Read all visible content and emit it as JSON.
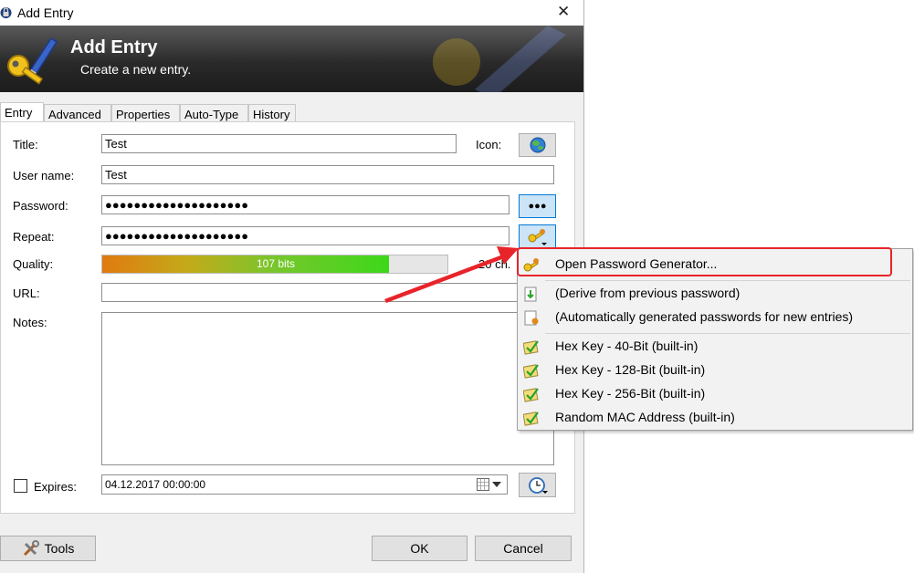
{
  "window": {
    "title": "Add Entry",
    "close_glyph": "✕",
    "icon": "lock-icon"
  },
  "banner": {
    "title": "Add Entry",
    "subtitle": "Create a new entry.",
    "icon": "key-pencil-icon"
  },
  "tabs": [
    {
      "label": "Entry",
      "active": true
    },
    {
      "label": "Advanced",
      "active": false
    },
    {
      "label": "Properties",
      "active": false
    },
    {
      "label": "Auto-Type",
      "active": false
    },
    {
      "label": "History",
      "active": false
    }
  ],
  "form": {
    "title_label": "Title:",
    "title_value": "Test",
    "icon_label": "Icon:",
    "username_label": "User name:",
    "username_value": "Test",
    "password_label": "Password:",
    "password_value": "●●●●●●●●●●●●●●●●●●●●",
    "show_password_glyph": "●●●",
    "repeat_label": "Repeat:",
    "repeat_value": "●●●●●●●●●●●●●●●●●●●●",
    "quality_label": "Quality:",
    "quality_text": "107 bits",
    "quality_fraction": 0.83,
    "quality_chars": "20 ch.",
    "url_label": "URL:",
    "url_value": "",
    "notes_label": "Notes:",
    "notes_value": "",
    "expires_label": "Expires:",
    "expires_checked": false,
    "expires_value": "04.12.2017 00:00:00"
  },
  "buttons": {
    "tools": "Tools",
    "ok": "OK",
    "cancel": "Cancel"
  },
  "menu": {
    "items": [
      {
        "label": "Open Password Generator...",
        "icon": "key-gear-icon",
        "highlighted": true
      },
      {
        "label": "(Derive from previous password)",
        "icon": "derive-arrow-icon"
      },
      {
        "label": "(Automatically generated passwords for new entries)",
        "icon": "document-gear-icon"
      },
      {
        "label": "Hex Key - 40-Bit (built-in)",
        "icon": "profile-check-icon"
      },
      {
        "label": "Hex Key - 128-Bit (built-in)",
        "icon": "profile-check-icon"
      },
      {
        "label": "Hex Key - 256-Bit (built-in)",
        "icon": "profile-check-icon"
      },
      {
        "label": "Random MAC Address (built-in)",
        "icon": "profile-check-icon"
      }
    ]
  },
  "colors": {
    "annotation_red": "#e8242a",
    "banner_dark": "#2a2a2a",
    "accent_blue": "#0078d7"
  }
}
